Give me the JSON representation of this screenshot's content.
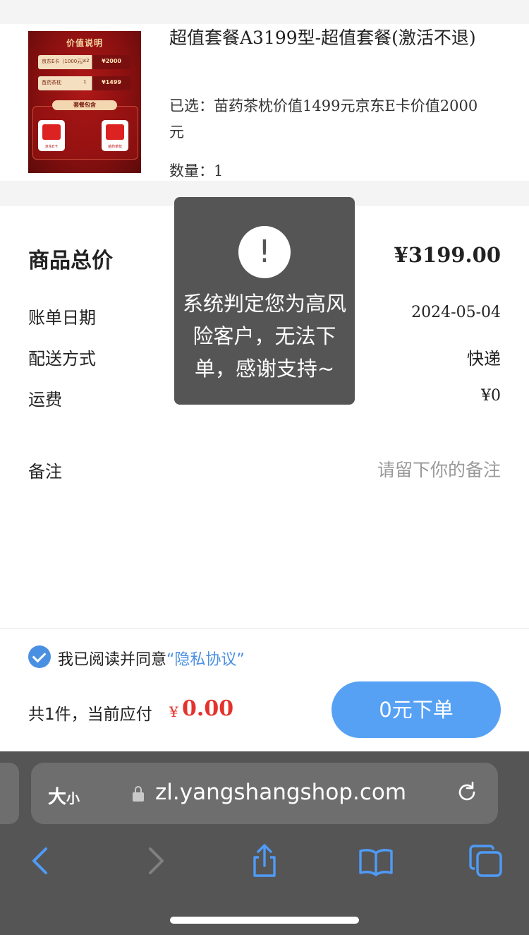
{
  "product": {
    "title": "超值套餐A3199型-超值套餐(激活不退)",
    "selected": "已选：苗药茶枕价值1499元京东E卡价值2000元",
    "quantity": "数量：1",
    "image": {
      "heading": "价值说明",
      "row1_label": "京东E卡（1000元）",
      "row1_multiplier": "x2",
      "row1_amount": "¥2000",
      "row2_label": "苗药茶枕",
      "row2_multiplier": "1",
      "row2_amount": "¥1499",
      "package_label": "套餐包含",
      "card1_label": "京东E卡",
      "card2_label": "苗药茶枕"
    }
  },
  "summary": {
    "total_label": "商品总价",
    "total_value": "¥3199.00",
    "date_label": "账单日期",
    "date_value": "2024-05-04",
    "shipping_label": "配送方式",
    "shipping_value": "快递",
    "fee_label": "运费",
    "fee_value": "¥0",
    "note_label": "备注",
    "note_placeholder": "请留下你的备注"
  },
  "toast": {
    "icon": "!",
    "message": "系统判定您为高风险客户，无法下单，感谢支持~"
  },
  "order": {
    "agree_text": "我已阅读并同意",
    "agree_link": "“隐私协议”",
    "count_label": "共1件，当前应付",
    "currency": "¥",
    "amount": "0.00",
    "submit_label": "0元下单"
  },
  "browser": {
    "text_size": "大",
    "text_size_small": "小",
    "url": "zl.yangshangshop.com"
  },
  "colors": {
    "accent_blue": "#57a1f4",
    "price_red": "#e5322d",
    "toast_bg": "#555555"
  }
}
